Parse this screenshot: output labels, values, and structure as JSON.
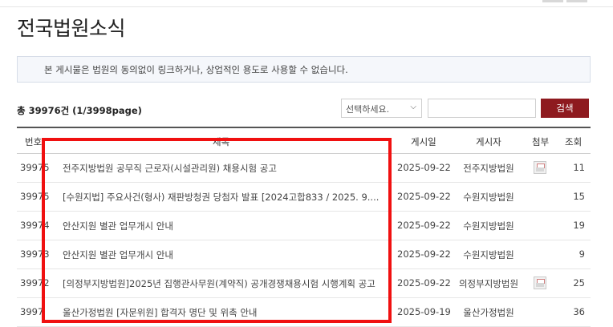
{
  "page_title": "전국법원소식",
  "notice": "본 게시물은 법원의 동의없이 링크하거나, 상업적인 용도로 사용할 수 없습니다.",
  "total_count": "총 39976건 (1/3998page)",
  "search": {
    "select_value": "선택하세요.",
    "input_value": "",
    "button_label": "검색"
  },
  "table": {
    "headers": {
      "num": "번호",
      "title": "제목",
      "date": "게시일",
      "writer": "게시자",
      "attach": "첨부",
      "views": "조회"
    },
    "rows": [
      {
        "num": "39975",
        "title": "전주지방법원 공무직 근로자(시설관리원) 채용시험 공고",
        "date": "2025-09-22",
        "writer": "전주지방법원",
        "attach": true,
        "views": "11"
      },
      {
        "num": "39975",
        "title": "[수원지법] 주요사건(형사) 재판방청권 당첨자 발표 [2024고합833 / 2025. 9....",
        "date": "2025-09-22",
        "writer": "수원지방법원",
        "attach": false,
        "views": "15"
      },
      {
        "num": "39974",
        "title": "안산지원 별관 업무개시 안내",
        "date": "2025-09-22",
        "writer": "수원지방법원",
        "attach": false,
        "views": "19"
      },
      {
        "num": "39973",
        "title": "안산지원 별관 업무개시 안내",
        "date": "2025-09-22",
        "writer": "수원지방법원",
        "attach": false,
        "views": "9"
      },
      {
        "num": "39972",
        "title": "[의정부지방법원]2025년 집행관사무원(계약직) 공개경쟁채용시험 시행계획 공고",
        "date": "2025-09-22",
        "writer": "의정부지방법원",
        "attach": true,
        "views": "25"
      },
      {
        "num": "3997",
        "title": "울산가정법원 [자문위원] 합격자 명단 및 위촉 안내",
        "date": "2025-09-19",
        "writer": "울산가정법원",
        "attach": false,
        "views": "36"
      }
    ]
  },
  "icons": {
    "attach": "file-attachment-icon",
    "dropdown": "chevron-down-icon"
  },
  "colors": {
    "search_button": "#8e1a1f",
    "highlight": "#f01010"
  }
}
